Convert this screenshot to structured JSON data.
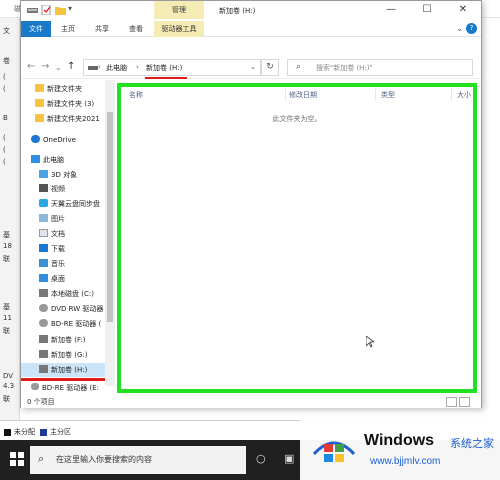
{
  "background_window": {
    "title": "磁盘管理",
    "left_fragments": [
      "文",
      "卷",
      "(",
      "(",
      "B",
      "(",
      "(",
      "(",
      "基",
      "18",
      "联",
      "基",
      "11",
      "联",
      "DV",
      "4.3",
      "联"
    ],
    "legend": [
      {
        "label": "未分配",
        "color": "#111111"
      },
      {
        "label": "主分区",
        "color": "#1f3a93"
      }
    ]
  },
  "explorer": {
    "manage_tab": "管理",
    "title": "新加卷 (H:)",
    "controls": {
      "minimize": "—",
      "maximize": "☐",
      "close": "✕"
    },
    "ribbon_tabs": [
      "文件",
      "主页",
      "共享",
      "查看",
      "驱动器工具"
    ],
    "address": {
      "crumb_pc": "此电脑",
      "crumb_sep": "›",
      "crumb_drive": "新加卷 (H:)",
      "search_placeholder": "搜索\"新加卷 (H:)\""
    },
    "nav_items": [
      {
        "label": "新建文件夹",
        "icon": "folder-icon"
      },
      {
        "label": "新建文件夹 (3)",
        "icon": "folder-icon"
      },
      {
        "label": "新建文件夹2021",
        "icon": "folder-icon"
      },
      {
        "label": "OneDrive",
        "icon": "cloud-icon"
      },
      {
        "label": "此电脑",
        "icon": "computer-icon"
      },
      {
        "label": "3D 对象",
        "icon": "cube-icon"
      },
      {
        "label": "视频",
        "icon": "video-icon"
      },
      {
        "label": "天翼云盘同步盘",
        "icon": "cloud-sync-icon"
      },
      {
        "label": "图片",
        "icon": "picture-icon"
      },
      {
        "label": "文档",
        "icon": "document-icon"
      },
      {
        "label": "下载",
        "icon": "download-icon"
      },
      {
        "label": "音乐",
        "icon": "music-icon"
      },
      {
        "label": "桌面",
        "icon": "desktop-icon"
      },
      {
        "label": "本地磁盘 (C:)",
        "icon": "drive-icon"
      },
      {
        "label": "DVD RW 驱动器",
        "icon": "dvd-icon"
      },
      {
        "label": "BD-RE 驱动器 (",
        "icon": "bd-icon"
      },
      {
        "label": "新加卷 (F:)",
        "icon": "drive-icon"
      },
      {
        "label": "新加卷 (G:)",
        "icon": "drive-icon"
      },
      {
        "label": "新加卷 (H:)",
        "icon": "drive-icon"
      }
    ],
    "nav_extra": "BD-RE 驱动器 (E:",
    "columns": [
      "名称",
      "修改日期",
      "类型",
      "大小"
    ],
    "empty_text": "此文件夹为空。",
    "status_text": "0 个项目"
  },
  "taskbar": {
    "search_placeholder": "在这里输入你要搜索的内容"
  },
  "watermark": {
    "title": "Windows",
    "subtitle": "系统之家",
    "url": "www.bjjmlv.com"
  }
}
